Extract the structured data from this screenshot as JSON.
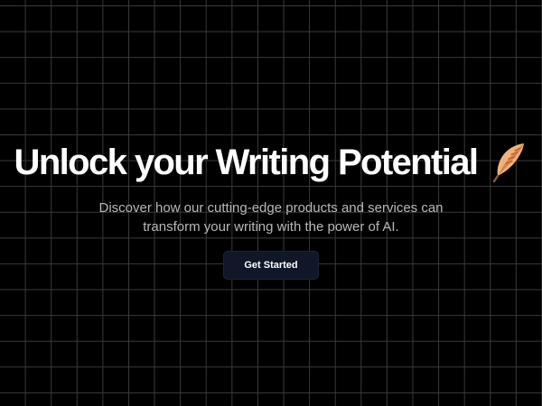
{
  "hero": {
    "headline": "Unlock your Writing Potential",
    "icon": "feather-quill-icon",
    "subtitle": "Discover how our cutting-edge products and services can transform your writing with the power of AI.",
    "cta_label": "Get Started"
  },
  "colors": {
    "background": "#000000",
    "grid": "#3a3a3a",
    "button": "#0f1729",
    "subtitle": "#b8b8b8"
  }
}
